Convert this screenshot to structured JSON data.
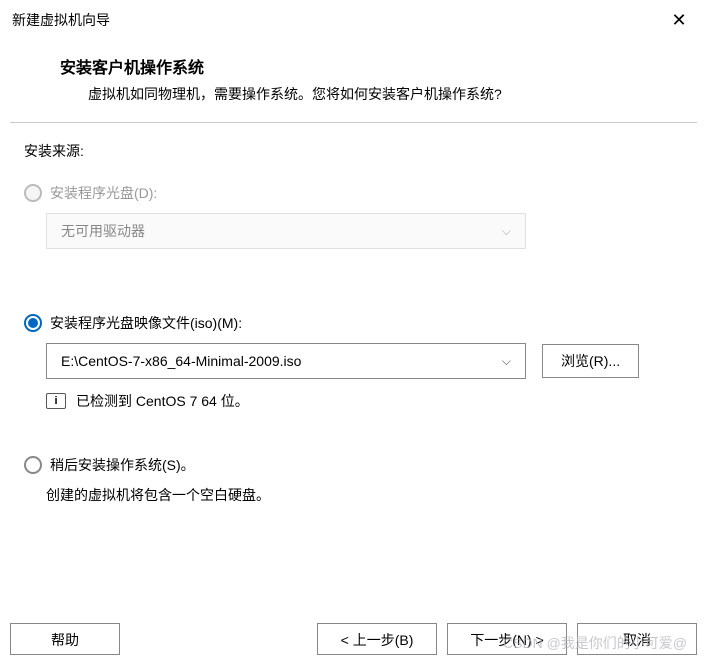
{
  "window": {
    "title": "新建虚拟机向导"
  },
  "header": {
    "title": "安装客户机操作系统",
    "subtitle": "虚拟机如同物理机，需要操作系统。您将如何安装客户机操作系统?"
  },
  "section_label": "安装来源:",
  "options": {
    "disc": {
      "label": "安装程序光盘(D):",
      "dropdown_value": "无可用驱动器"
    },
    "iso": {
      "label": "安装程序光盘映像文件(iso)(M):",
      "path": "E:\\CentOS-7-x86_64-Minimal-2009.iso",
      "browse_label": "浏览(R)...",
      "info_icon": "i",
      "info_text": "已检测到 CentOS 7 64 位。"
    },
    "later": {
      "label": "稍后安装操作系统(S)。",
      "desc": "创建的虚拟机将包含一个空白硬盘。"
    }
  },
  "footer": {
    "help": "帮助",
    "back": "< 上一步(B)",
    "next": "下一步(N) >",
    "cancel": "取消"
  },
  "watermark": "CSDN @我是你们的小可爱@"
}
